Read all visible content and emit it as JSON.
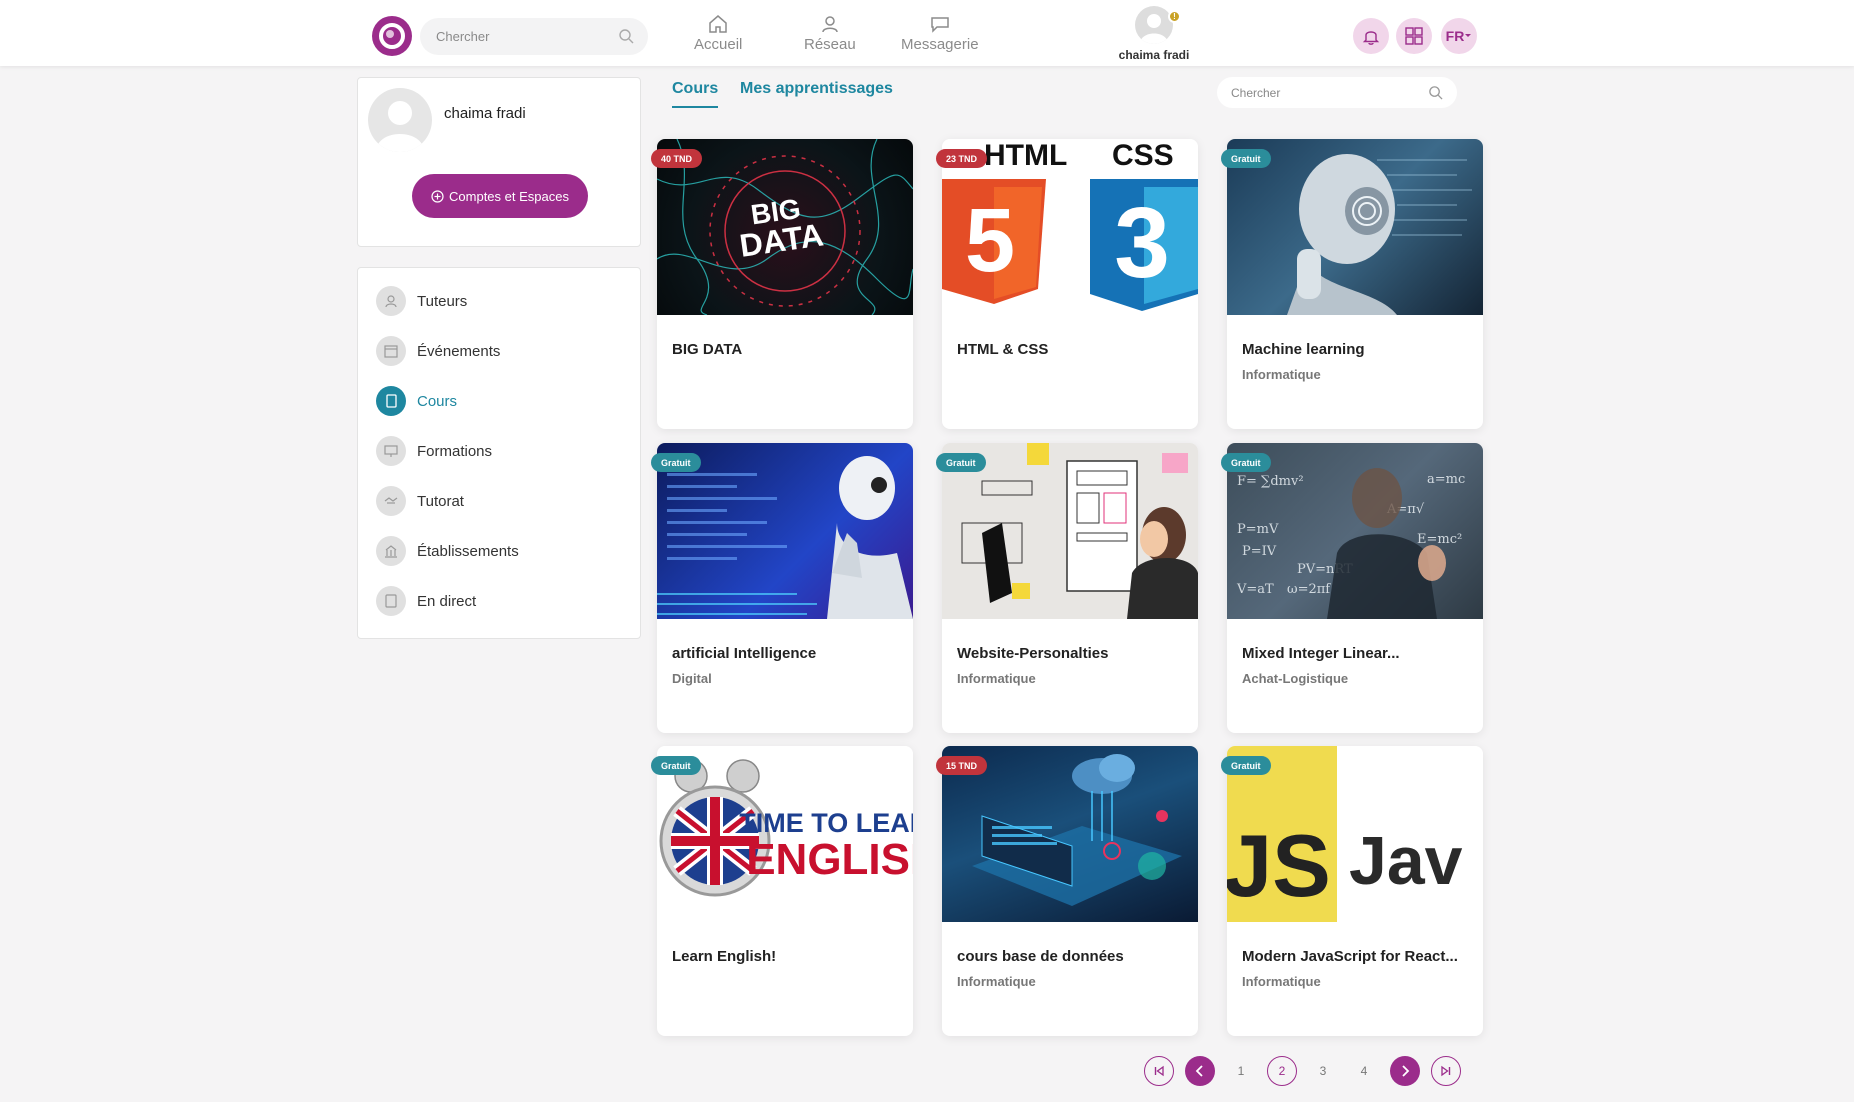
{
  "header": {
    "search_placeholder": "Chercher",
    "nav": [
      {
        "label": "Accueil",
        "icon": "home-icon"
      },
      {
        "label": "Réseau",
        "icon": "network-icon"
      },
      {
        "label": "Messagerie",
        "icon": "chat-icon"
      }
    ],
    "user_name": "chaima fradi",
    "notification_dot": "!",
    "language": "FR"
  },
  "sidebar": {
    "profile_name": "chaima fradi",
    "comptes_button": "Comptes et Espaces",
    "items": [
      {
        "label": "Tuteurs",
        "icon": "tutor-icon"
      },
      {
        "label": "Événements",
        "icon": "calendar-icon"
      },
      {
        "label": "Cours",
        "icon": "book-icon",
        "active": true
      },
      {
        "label": "Formations",
        "icon": "presentation-icon"
      },
      {
        "label": "Tutorat",
        "icon": "handshake-icon"
      },
      {
        "label": "Établissements",
        "icon": "building-icon"
      },
      {
        "label": "En direct",
        "icon": "live-icon"
      }
    ]
  },
  "tabs": [
    {
      "label": "Cours",
      "active": true
    },
    {
      "label": "Mes apprentissages",
      "active": false
    }
  ],
  "content_search_placeholder": "Chercher",
  "courses": [
    {
      "title": "BIG DATA",
      "category": "",
      "badge": "40 TND",
      "badge_type": "paid"
    },
    {
      "title": "HTML & CSS",
      "category": "",
      "badge": "23 TND",
      "badge_type": "paid"
    },
    {
      "title": "Machine learning",
      "category": "Informatique",
      "badge": "Gratuit",
      "badge_type": "free"
    },
    {
      "title": "artificial Intelligence",
      "category": "Digital",
      "badge": "Gratuit",
      "badge_type": "free"
    },
    {
      "title": "Website-Personalties",
      "category": "Informatique",
      "badge": "Gratuit",
      "badge_type": "free"
    },
    {
      "title": "Mixed Integer Linear...",
      "category": "Achat-Logistique",
      "badge": "Gratuit",
      "badge_type": "free"
    },
    {
      "title": "Learn English!",
      "category": "",
      "badge": "Gratuit",
      "badge_type": "free"
    },
    {
      "title": "cours base de données",
      "category": "Informatique",
      "badge": "15 TND",
      "badge_type": "paid"
    },
    {
      "title": "Modern JavaScript for React...",
      "category": "Informatique",
      "badge": "Gratuit",
      "badge_type": "free"
    }
  ],
  "thumb_text": {
    "bigdata": "BIG DATA",
    "html_top": "HTML",
    "css_top": "CSS",
    "html_num": "5",
    "css_num": "3",
    "english_1": "TIME TO LEARN",
    "english_2": "ENGLISH",
    "js_1": "JS",
    "js_2": "Jav"
  },
  "pagination": {
    "pages": [
      "1",
      "2",
      "3",
      "4"
    ],
    "current": "2"
  },
  "colors": {
    "brand": "#9b2c8b",
    "accent": "#1e87a0",
    "paid_badge": "#c1343c",
    "free_badge": "#2b8d9b"
  }
}
